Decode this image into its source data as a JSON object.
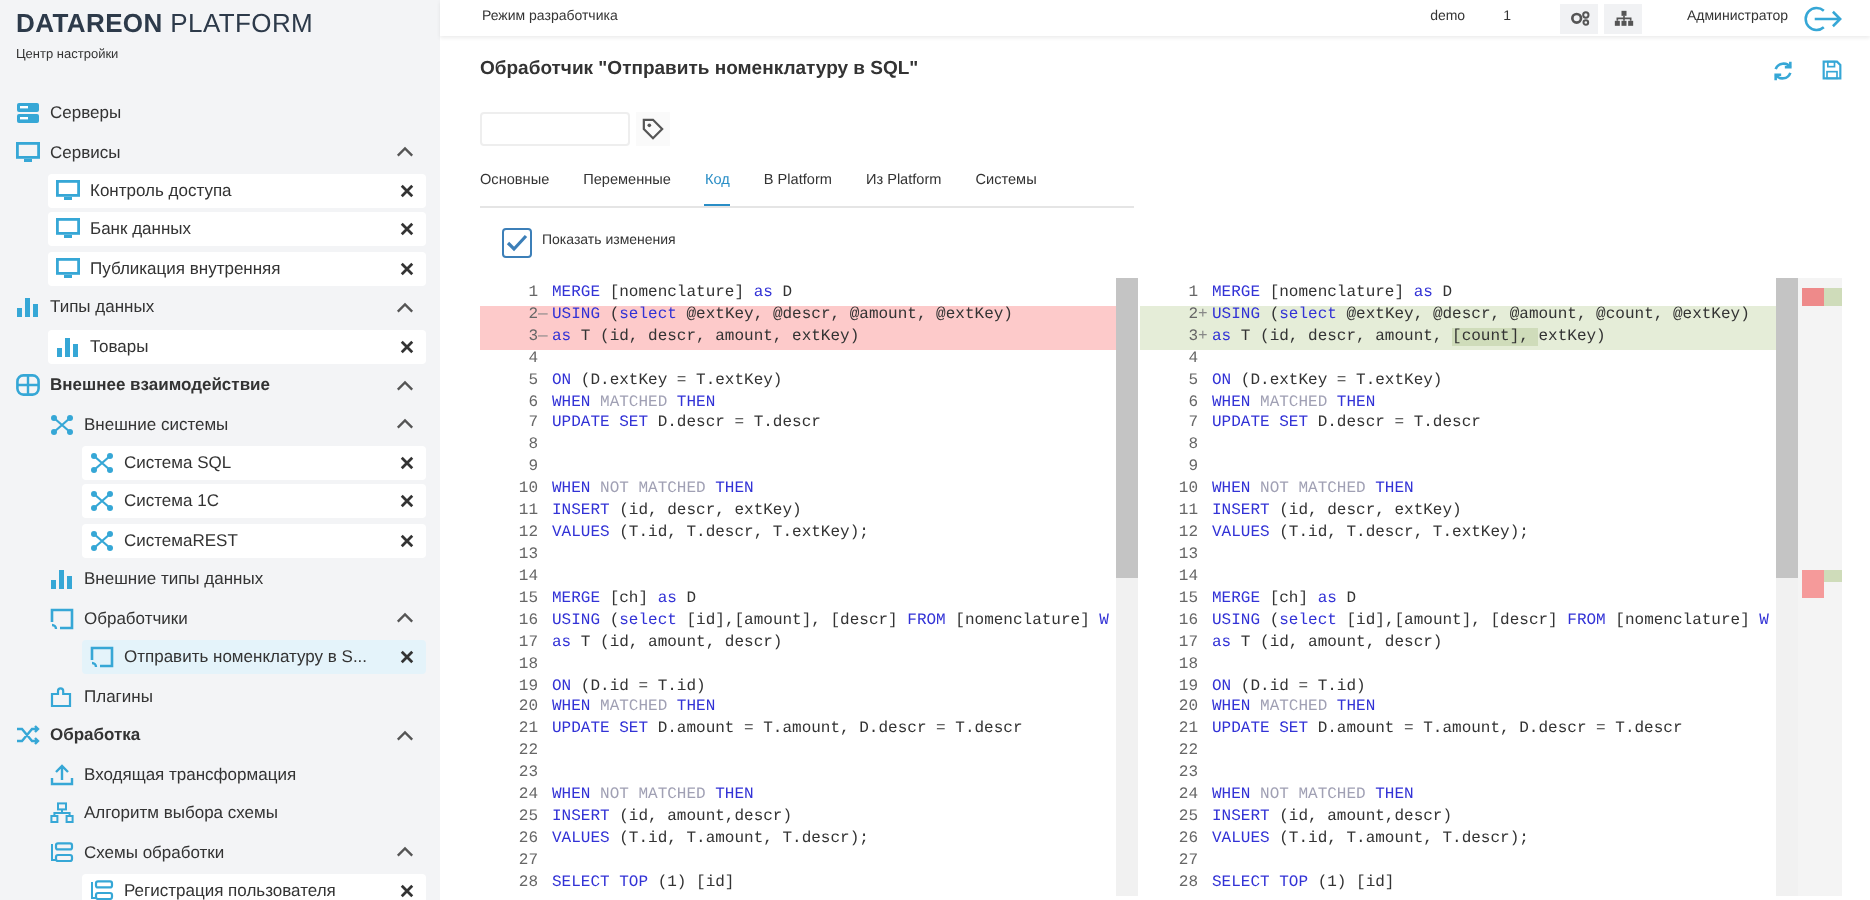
{
  "sidebar": {
    "logo": "**DATAREON** PLATFORM",
    "subtitle": "Центр настройки",
    "items": [
      {
        "kind": "node",
        "label": "Серверы"
      },
      {
        "kind": "node",
        "label": "Сервисы",
        "expanded": true,
        "children": [
          {
            "kind": "leaf",
            "label": "Контроль доступа",
            "selected": false
          },
          {
            "kind": "leaf",
            "label": "Банк данных",
            "selected": false
          },
          {
            "kind": "leaf",
            "label": "Публикация внутренняя",
            "selected": false
          }
        ]
      },
      {
        "kind": "node",
        "label": "Типы данных",
        "expanded": true,
        "children": [
          {
            "kind": "leaf",
            "label": "Товары",
            "selected": false
          }
        ]
      },
      {
        "kind": "section",
        "label": "Внешнее взаимодействие",
        "expanded": true,
        "children": [
          {
            "kind": "node",
            "label": "Внешние системы",
            "expanded": true,
            "children": [
              {
                "kind": "leaf",
                "label": "Система SQL",
                "selected": false
              },
              {
                "kind": "leaf",
                "label": "Система 1С",
                "selected": false
              },
              {
                "kind": "leaf",
                "label": "СистемаREST",
                "selected": false
              }
            ]
          },
          {
            "kind": "node",
            "label": "Внешние типы данных"
          },
          {
            "kind": "node",
            "label": "Обработчики",
            "expanded": true,
            "children": [
              {
                "kind": "leaf",
                "label": "Отправить номенклатуру в S...",
                "selected": true
              }
            ]
          },
          {
            "kind": "node",
            "label": "Плагины"
          }
        ]
      },
      {
        "kind": "section",
        "label": "Обработка",
        "expanded": true,
        "children": [
          {
            "kind": "node",
            "label": "Входящая трансформация"
          },
          {
            "kind": "node",
            "label": "Алгоритм выбора схемы"
          },
          {
            "kind": "node",
            "label": "Схемы обработки",
            "expanded": true,
            "children": [
              {
                "kind": "leaf",
                "label": "Регистрация пользователя",
                "selected": false
              }
            ]
          }
        ]
      }
    ]
  },
  "topbar": {
    "mode": "Режим разработчика",
    "user": "demo",
    "count": "1",
    "role": "Администратор"
  },
  "title": "Обработчик \"Отправить номенклатуру в SQL\"",
  "tabs": [
    {
      "label": "Основные",
      "selected": false
    },
    {
      "label": "Переменные",
      "selected": false
    },
    {
      "label": "Код",
      "selected": true
    },
    {
      "label": "В Platform",
      "selected": false
    },
    {
      "label": "Из Platform",
      "selected": false
    },
    {
      "label": "Системы",
      "selected": false
    }
  ],
  "show_changes": {
    "label": "Показать изменения",
    "checked": true
  },
  "editors": [
    {
      "lines": [
        {
          "no": "1",
          "kind": "plain",
          "tokens": [
            {
              "kind": "keyword",
              "text": "MERGE"
            },
            {
              "kind": "text",
              "text": " [nomenclature] "
            },
            {
              "kind": "keyword",
              "text": "as"
            },
            {
              "kind": "text",
              "text": " D"
            }
          ]
        },
        {
          "no": "2",
          "kind": "removed",
          "marker": "—",
          "tokens": [
            {
              "kind": "keyword",
              "text": "USING"
            },
            {
              "kind": "text",
              "text": " ("
            },
            {
              "kind": "keyword",
              "text": "select"
            },
            {
              "kind": "text",
              "text": " @extKey, @descr, @amount, @extKey)"
            }
          ]
        },
        {
          "no": "3",
          "kind": "removed",
          "marker": "—",
          "tokens": [
            {
              "kind": "keyword",
              "text": "as"
            },
            {
              "kind": "text",
              "text": " T (id, descr, amount, extKey)"
            }
          ]
        },
        {
          "no": "4",
          "kind": "plain"
        },
        {
          "no": "5",
          "kind": "plain",
          "tokens": [
            {
              "kind": "keyword",
              "text": "ON"
            },
            {
              "kind": "text",
              "text": " (D.extKey = T.extKey)"
            }
          ]
        },
        {
          "no": "6",
          "kind": "plain",
          "tokens": [
            {
              "kind": "keyword",
              "text": "WHEN "
            },
            {
              "kind": "muted",
              "text": "MATCHED "
            },
            {
              "kind": "keyword",
              "text": "THEN"
            }
          ]
        },
        {
          "no": "7",
          "kind": "plain",
          "tokens": [
            {
              "kind": "keyword",
              "text": "UPDATE SET"
            },
            {
              "kind": "text",
              "text": " D.descr = T.descr"
            }
          ]
        },
        {
          "no": "8",
          "kind": "plain"
        },
        {
          "no": "9",
          "kind": "plain"
        },
        {
          "no": "10",
          "kind": "plain",
          "tokens": [
            {
              "kind": "keyword",
              "text": "WHEN "
            },
            {
              "kind": "muted",
              "text": "NOT MATCHED "
            },
            {
              "kind": "keyword",
              "text": "THEN"
            }
          ]
        },
        {
          "no": "11",
          "kind": "plain",
          "tokens": [
            {
              "kind": "keyword",
              "text": "INSERT"
            },
            {
              "kind": "text",
              "text": " (id, descr, extKey)"
            }
          ]
        },
        {
          "no": "12",
          "kind": "plain",
          "tokens": [
            {
              "kind": "keyword",
              "text": "VALUES"
            },
            {
              "kind": "text",
              "text": " (T.id, T.descr, T.extKey);"
            }
          ]
        },
        {
          "no": "13",
          "kind": "plain"
        },
        {
          "no": "14",
          "kind": "plain"
        },
        {
          "no": "15",
          "kind": "plain",
          "tokens": [
            {
              "kind": "keyword",
              "text": "MERGE"
            },
            {
              "kind": "text",
              "text": " [ch] "
            },
            {
              "kind": "keyword",
              "text": "as"
            },
            {
              "kind": "text",
              "text": " D"
            }
          ]
        },
        {
          "no": "16",
          "kind": "plain",
          "tokens": [
            {
              "kind": "keyword",
              "text": "USING"
            },
            {
              "kind": "text",
              "text": " ("
            },
            {
              "kind": "keyword",
              "text": "select"
            },
            {
              "kind": "text",
              "text": " [id],[amount], [descr] "
            },
            {
              "kind": "keyword",
              "text": "FROM"
            },
            {
              "kind": "text",
              "text": " [nomenclature] "
            },
            {
              "kind": "keyword",
              "text": "W"
            }
          ]
        },
        {
          "no": "17",
          "kind": "plain",
          "tokens": [
            {
              "kind": "keyword",
              "text": "as"
            },
            {
              "kind": "text",
              "text": " T (id, amount, descr)"
            }
          ]
        },
        {
          "no": "18",
          "kind": "plain"
        },
        {
          "no": "19",
          "kind": "plain",
          "tokens": [
            {
              "kind": "keyword",
              "text": "ON"
            },
            {
              "kind": "text",
              "text": " (D.id = T.id)"
            }
          ]
        },
        {
          "no": "20",
          "kind": "plain",
          "tokens": [
            {
              "kind": "keyword",
              "text": "WHEN "
            },
            {
              "kind": "muted",
              "text": "MATCHED "
            },
            {
              "kind": "keyword",
              "text": "THEN"
            }
          ]
        },
        {
          "no": "21",
          "kind": "plain",
          "tokens": [
            {
              "kind": "keyword",
              "text": "UPDATE SET"
            },
            {
              "kind": "text",
              "text": " D.amount = T.amount, D.descr = T.descr"
            }
          ]
        },
        {
          "no": "22",
          "kind": "plain"
        },
        {
          "no": "23",
          "kind": "plain"
        },
        {
          "no": "24",
          "kind": "plain",
          "tokens": [
            {
              "kind": "keyword",
              "text": "WHEN "
            },
            {
              "kind": "muted",
              "text": "NOT MATCHED "
            },
            {
              "kind": "keyword",
              "text": "THEN"
            }
          ]
        },
        {
          "no": "25",
          "kind": "plain",
          "tokens": [
            {
              "kind": "keyword",
              "text": "INSERT"
            },
            {
              "kind": "text",
              "text": " (id, amount,descr)"
            }
          ]
        },
        {
          "no": "26",
          "kind": "plain",
          "tokens": [
            {
              "kind": "keyword",
              "text": "VALUES"
            },
            {
              "kind": "text",
              "text": " (T.id, T.amount, T.descr);"
            }
          ]
        },
        {
          "no": "27",
          "kind": "plain"
        },
        {
          "no": "28",
          "kind": "plain",
          "tokens": [
            {
              "kind": "keyword",
              "text": "SELECT TOP"
            },
            {
              "kind": "text",
              "text": " (1) [id]"
            }
          ]
        }
      ]
    },
    {
      "lines": [
        {
          "no": "1",
          "kind": "plain",
          "tokens": [
            {
              "kind": "keyword",
              "text": "MERGE"
            },
            {
              "kind": "text",
              "text": " [nomenclature] "
            },
            {
              "kind": "keyword",
              "text": "as"
            },
            {
              "kind": "text",
              "text": " D"
            }
          ]
        },
        {
          "no": "2",
          "kind": "added",
          "marker": "+",
          "tokens": [
            {
              "kind": "keyword",
              "text": "USING"
            },
            {
              "kind": "text",
              "text": " ("
            },
            {
              "kind": "keyword",
              "text": "select"
            },
            {
              "kind": "text",
              "text": " @extKey, @descr, @amount, @count, @extKey)"
            }
          ]
        },
        {
          "no": "3",
          "kind": "added",
          "marker": "+",
          "tokens": [
            {
              "kind": "keyword",
              "text": "as"
            },
            {
              "kind": "text",
              "text": " T (id, descr, amount, "
            },
            {
              "kind": "inserted",
              "text": "[count], "
            },
            {
              "kind": "text",
              "text": "extKey)"
            }
          ]
        },
        {
          "no": "4",
          "kind": "plain"
        },
        {
          "no": "5",
          "kind": "plain",
          "tokens": [
            {
              "kind": "keyword",
              "text": "ON"
            },
            {
              "kind": "text",
              "text": " (D.extKey = T.extKey)"
            }
          ]
        },
        {
          "no": "6",
          "kind": "plain",
          "tokens": [
            {
              "kind": "keyword",
              "text": "WHEN "
            },
            {
              "kind": "muted",
              "text": "MATCHED "
            },
            {
              "kind": "keyword",
              "text": "THEN"
            }
          ]
        },
        {
          "no": "7",
          "kind": "plain",
          "tokens": [
            {
              "kind": "keyword",
              "text": "UPDATE SET"
            },
            {
              "kind": "text",
              "text": " D.descr = T.descr"
            }
          ]
        },
        {
          "no": "8",
          "kind": "plain"
        },
        {
          "no": "9",
          "kind": "plain"
        },
        {
          "no": "10",
          "kind": "plain",
          "tokens": [
            {
              "kind": "keyword",
              "text": "WHEN "
            },
            {
              "kind": "muted",
              "text": "NOT MATCHED "
            },
            {
              "kind": "keyword",
              "text": "THEN"
            }
          ]
        },
        {
          "no": "11",
          "kind": "plain",
          "tokens": [
            {
              "kind": "keyword",
              "text": "INSERT"
            },
            {
              "kind": "text",
              "text": " (id, descr, extKey)"
            }
          ]
        },
        {
          "no": "12",
          "kind": "plain",
          "tokens": [
            {
              "kind": "keyword",
              "text": "VALUES"
            },
            {
              "kind": "text",
              "text": " (T.id, T.descr, T.extKey);"
            }
          ]
        },
        {
          "no": "13",
          "kind": "plain"
        },
        {
          "no": "14",
          "kind": "plain"
        },
        {
          "no": "15",
          "kind": "plain",
          "tokens": [
            {
              "kind": "keyword",
              "text": "MERGE"
            },
            {
              "kind": "text",
              "text": " [ch] "
            },
            {
              "kind": "keyword",
              "text": "as"
            },
            {
              "kind": "text",
              "text": " D"
            }
          ]
        },
        {
          "no": "16",
          "kind": "plain",
          "tokens": [
            {
              "kind": "keyword",
              "text": "USING"
            },
            {
              "kind": "text",
              "text": " ("
            },
            {
              "kind": "keyword",
              "text": "select"
            },
            {
              "kind": "text",
              "text": " [id],[amount], [descr] "
            },
            {
              "kind": "keyword",
              "text": "FROM"
            },
            {
              "kind": "text",
              "text": " [nomenclature] "
            },
            {
              "kind": "keyword",
              "text": "W"
            }
          ]
        },
        {
          "no": "17",
          "kind": "plain",
          "tokens": [
            {
              "kind": "keyword",
              "text": "as"
            },
            {
              "kind": "text",
              "text": " T (id, amount, descr)"
            }
          ]
        },
        {
          "no": "18",
          "kind": "plain"
        },
        {
          "no": "19",
          "kind": "plain",
          "tokens": [
            {
              "kind": "keyword",
              "text": "ON"
            },
            {
              "kind": "text",
              "text": " (D.id = T.id)"
            }
          ]
        },
        {
          "no": "20",
          "kind": "plain",
          "tokens": [
            {
              "kind": "keyword",
              "text": "WHEN "
            },
            {
              "kind": "muted",
              "text": "MATCHED "
            },
            {
              "kind": "keyword",
              "text": "THEN"
            }
          ]
        },
        {
          "no": "21",
          "kind": "plain",
          "tokens": [
            {
              "kind": "keyword",
              "text": "UPDATE SET"
            },
            {
              "kind": "text",
              "text": " D.amount = T.amount, D.descr = T.descr"
            }
          ]
        },
        {
          "no": "22",
          "kind": "plain"
        },
        {
          "no": "23",
          "kind": "plain"
        },
        {
          "no": "24",
          "kind": "plain",
          "tokens": [
            {
              "kind": "keyword",
              "text": "WHEN "
            },
            {
              "kind": "muted",
              "text": "NOT MATCHED "
            },
            {
              "kind": "keyword",
              "text": "THEN"
            }
          ]
        },
        {
          "no": "25",
          "kind": "plain",
          "tokens": [
            {
              "kind": "keyword",
              "text": "INSERT"
            },
            {
              "kind": "text",
              "text": " (id, amount,descr)"
            }
          ]
        },
        {
          "no": "26",
          "kind": "plain",
          "tokens": [
            {
              "kind": "keyword",
              "text": "VALUES"
            },
            {
              "kind": "text",
              "text": " (T.id, T.amount, T.descr);"
            }
          ]
        },
        {
          "no": "27",
          "kind": "plain"
        },
        {
          "no": "28",
          "kind": "plain",
          "tokens": [
            {
              "kind": "keyword",
              "text": "SELECT TOP"
            },
            {
              "kind": "text",
              "text": " (1) [id]"
            }
          ]
        }
      ]
    }
  ]
}
